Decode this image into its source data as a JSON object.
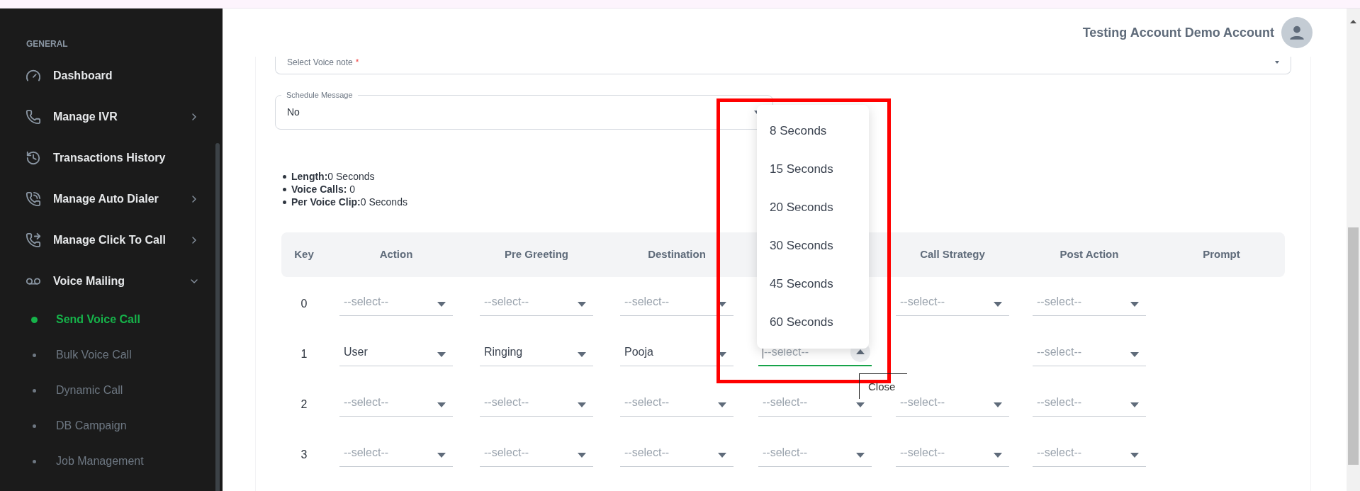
{
  "sidebar": {
    "section": "GENERAL",
    "items": [
      {
        "label": "Dashboard"
      },
      {
        "label": "Manage IVR",
        "expanded": false
      },
      {
        "label": "Transactions History"
      },
      {
        "label": "Manage Auto Dialer",
        "expanded": false
      },
      {
        "label": "Manage Click To Call",
        "expanded": false
      },
      {
        "label": "Voice Mailing",
        "expanded": true,
        "children": [
          {
            "label": "Send Voice Call",
            "selected": true
          },
          {
            "label": "Bulk Voice Call",
            "selected": false
          },
          {
            "label": "Dynamic Call",
            "selected": false
          },
          {
            "label": "DB Campaign",
            "selected": false
          },
          {
            "label": "Job Management",
            "selected": false
          }
        ]
      }
    ]
  },
  "header": {
    "user_name": "Testing Account Demo Account"
  },
  "form": {
    "voice_note": {
      "placeholder": "Select Voice note",
      "required_mark": "*"
    },
    "schedule": {
      "label": "Schedule Message",
      "value": "No"
    },
    "summary": [
      {
        "label": "Length:",
        "value": "0 Seconds"
      },
      {
        "label": "Voice Calls:",
        "value": " 0"
      },
      {
        "label": "Per Voice Clip:",
        "value": "0 Seconds"
      }
    ]
  },
  "table": {
    "columns": [
      "Key",
      "Action",
      "Pre Greeting",
      "Destination",
      null,
      "Call Strategy",
      "Post Action",
      "Prompt"
    ],
    "rows": [
      {
        "key": "0",
        "cells": [
          {
            "kind": "select",
            "placeholder": "--select--"
          },
          {
            "kind": "select",
            "placeholder": "--select--"
          },
          {
            "kind": "select",
            "placeholder": "--select--"
          },
          {
            "kind": "empty"
          },
          {
            "kind": "select",
            "placeholder": "--select--"
          },
          {
            "kind": "select",
            "placeholder": "--select--"
          },
          {
            "kind": "empty"
          }
        ]
      },
      {
        "key": "1",
        "cells": [
          {
            "kind": "select",
            "value": "User"
          },
          {
            "kind": "select",
            "value": "Ringing"
          },
          {
            "kind": "select",
            "value": "Pooja"
          },
          {
            "kind": "select",
            "placeholder": "--select--",
            "open": true
          },
          {
            "kind": "empty"
          },
          {
            "kind": "select",
            "placeholder": "--select--"
          },
          {
            "kind": "empty"
          }
        ]
      },
      {
        "key": "2",
        "cells": [
          {
            "kind": "select",
            "placeholder": "--select--"
          },
          {
            "kind": "select",
            "placeholder": "--select--"
          },
          {
            "kind": "select",
            "placeholder": "--select--"
          },
          {
            "kind": "select",
            "placeholder": "--select--"
          },
          {
            "kind": "select",
            "placeholder": "--select--"
          },
          {
            "kind": "select",
            "placeholder": "--select--"
          },
          {
            "kind": "empty"
          }
        ]
      },
      {
        "key": "3",
        "cells": [
          {
            "kind": "select",
            "placeholder": "--select--"
          },
          {
            "kind": "select",
            "placeholder": "--select--"
          },
          {
            "kind": "select",
            "placeholder": "--select--"
          },
          {
            "kind": "select",
            "placeholder": "--select--"
          },
          {
            "kind": "select",
            "placeholder": "--select--"
          },
          {
            "kind": "select",
            "placeholder": "--select--"
          },
          {
            "kind": "empty"
          }
        ]
      }
    ]
  },
  "dropdown": {
    "options": [
      "8 Seconds",
      "15 Seconds",
      "20 Seconds",
      "30 Seconds",
      "45 Seconds",
      "60 Seconds"
    ]
  },
  "tooltip": {
    "text": "Close"
  }
}
